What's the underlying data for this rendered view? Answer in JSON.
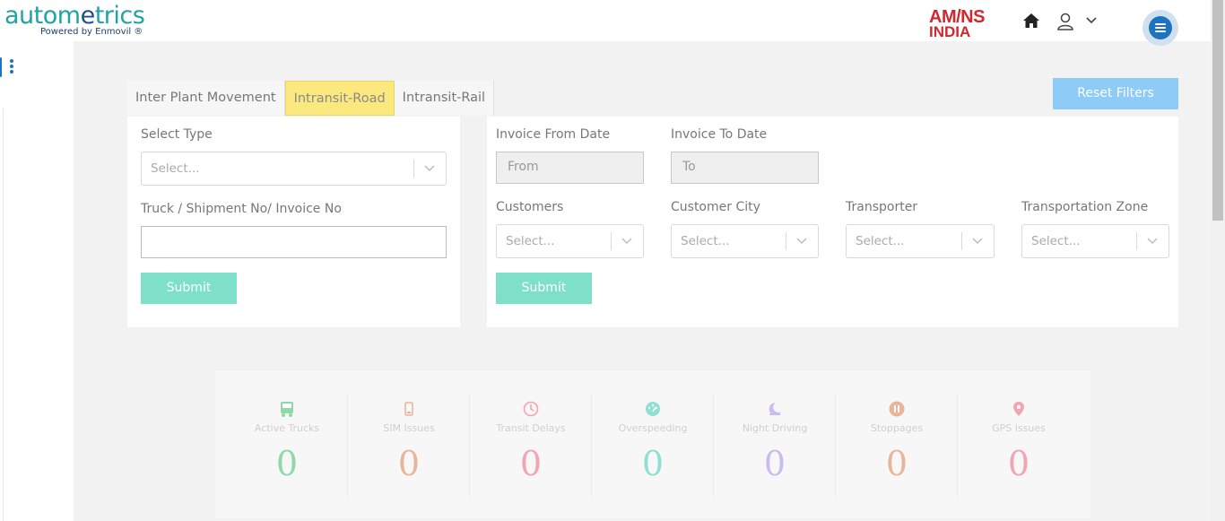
{
  "header": {
    "logo_part1": "autom",
    "logo_part2": "e",
    "logo_part3": "trics",
    "logo_sub": "Powered by Enmovil ®",
    "brand_line1": "AM/NS",
    "brand_line2": "INDIA"
  },
  "tabs": [
    {
      "label": "Inter Plant Movement",
      "active": false
    },
    {
      "label": "Intransit-Road",
      "active": true
    },
    {
      "label": "Intransit-Rail",
      "active": false
    }
  ],
  "reset_label": "Reset Filters",
  "left_form": {
    "select_type_label": "Select Type",
    "select_type_placeholder": "Select...",
    "search_label": "Truck / Shipment No/ Invoice No",
    "search_value": "",
    "submit_label": "Submit"
  },
  "right_form": {
    "from_label": "Invoice From Date",
    "from_placeholder": "From",
    "to_label": "Invoice To Date",
    "to_placeholder": "To",
    "customers_label": "Customers",
    "customer_city_label": "Customer City",
    "transporter_label": "Transporter",
    "zone_label": "Transportation Zone",
    "select_placeholder": "Select...",
    "submit_label": "Submit"
  },
  "stats": [
    {
      "name": "Active Trucks",
      "value": "0",
      "color": "#8fd9a8",
      "icon": "truck-icon"
    },
    {
      "name": "SIM Issues",
      "value": "0",
      "color": "#e9b49a",
      "icon": "sim-icon"
    },
    {
      "name": "Transit Delays",
      "value": "0",
      "color": "#f4a3b0",
      "icon": "clock-icon"
    },
    {
      "name": "Overspeeding",
      "value": "0",
      "color": "#8fe0d2",
      "icon": "speedometer-icon"
    },
    {
      "name": "Night Driving",
      "value": "0",
      "color": "#cbbcf0",
      "icon": "moon-icon"
    },
    {
      "name": "Stoppages",
      "value": "0",
      "color": "#e9b49a",
      "icon": "pause-icon"
    },
    {
      "name": "GPS Issues",
      "value": "0",
      "color": "#f4a3b0",
      "icon": "map-pin-icon"
    }
  ]
}
